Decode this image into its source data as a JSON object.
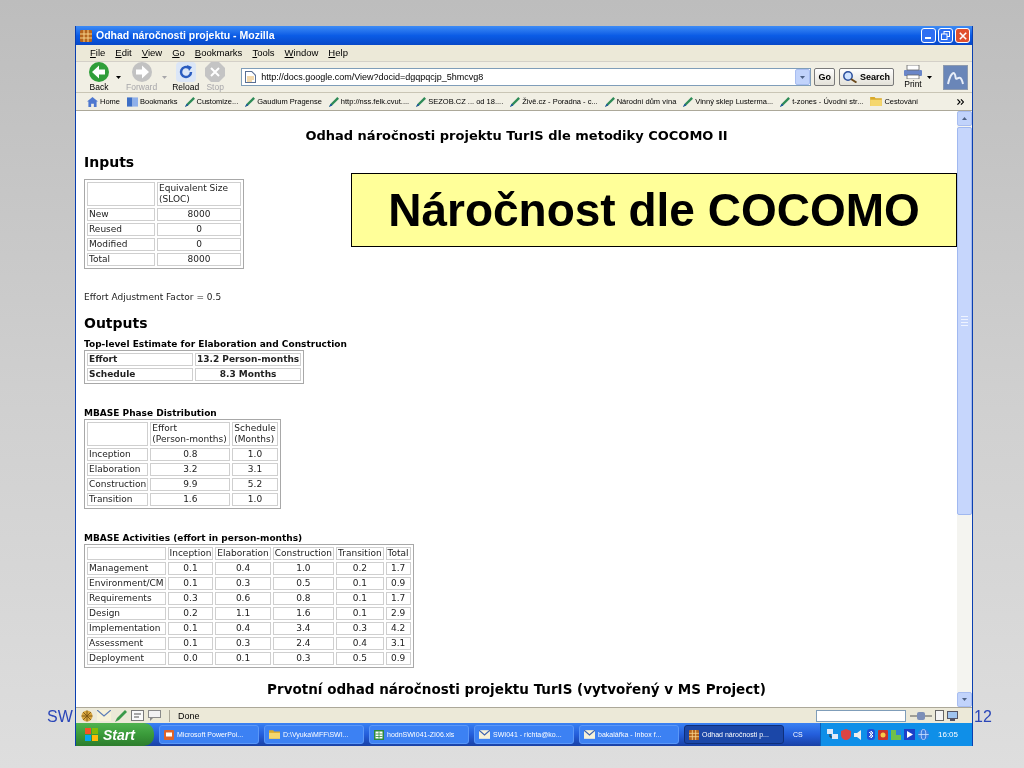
{
  "slide": {
    "footer_left": "SW",
    "page_number": "12",
    "callout": "Náročnost dle COCOMO"
  },
  "window": {
    "title": "Odhad náročnosti projektu - Mozilla"
  },
  "menu": [
    "File",
    "Edit",
    "View",
    "Go",
    "Bookmarks",
    "Tools",
    "Window",
    "Help"
  ],
  "navigation": [
    {
      "label": "Back",
      "kind": "back",
      "disabled": false,
      "has_menu": true
    },
    {
      "label": "Forward",
      "kind": "forward",
      "disabled": true,
      "has_menu": true
    },
    {
      "label": "Reload",
      "kind": "reload",
      "disabled": false,
      "has_menu": false
    },
    {
      "label": "Stop",
      "kind": "stop",
      "disabled": true,
      "has_menu": false
    }
  ],
  "address_bar": {
    "value": "http://docs.google.com/View?docid=dgqpqcjp_5hmcvg8"
  },
  "go_button": "Go",
  "search_button": "Search",
  "print_button": "Print",
  "bookmarks": [
    {
      "label": "Home",
      "kind": "home"
    },
    {
      "label": "Bookmarks",
      "kind": "bookmarks"
    },
    {
      "label": "Customize...",
      "kind": "link"
    },
    {
      "label": "Gaudium Pragense",
      "kind": "link"
    },
    {
      "label": "http://nss.felk.cvut....",
      "kind": "link"
    },
    {
      "label": "SEZOB.CZ ... od 18....",
      "kind": "link"
    },
    {
      "label": "Živě.cz - Poradna - c...",
      "kind": "link"
    },
    {
      "label": "Národní dům vína",
      "kind": "link"
    },
    {
      "label": "Vinný sklep Lusterma...",
      "kind": "link"
    },
    {
      "label": "t-zones - Úvodní str...",
      "kind": "link"
    },
    {
      "label": "Cestování",
      "kind": "folder"
    }
  ],
  "page": {
    "title": "Odhad náročnosti projektu TurIS dle metodiky COCOMO II",
    "inputs": {
      "heading": "Inputs",
      "columns": [
        "Equivalent Size (SLOC)"
      ],
      "rows": [
        {
          "label": "New",
          "values": [
            "8000"
          ]
        },
        {
          "label": "Reused",
          "values": [
            "0"
          ]
        },
        {
          "label": "Modified",
          "values": [
            "0"
          ]
        },
        {
          "label": "Total",
          "values": [
            "8000"
          ]
        }
      ]
    },
    "adjustment_factor": "Effort Adjustment Factor = 0.5",
    "outputs": {
      "heading": "Outputs",
      "estimate": {
        "caption": "Top-level Estimate for Elaboration and Construction",
        "rows": [
          {
            "label": "Effort",
            "value": "13.2 Person-months"
          },
          {
            "label": "Schedule",
            "value": "8.3 Months"
          }
        ]
      },
      "phase_distribution": {
        "caption": "MBASE Phase Distribution",
        "columns": [
          "Effort (Person-months)",
          "Schedule (Months)"
        ],
        "rows": [
          {
            "label": "Inception",
            "values": [
              "0.8",
              "1.0"
            ]
          },
          {
            "label": "Elaboration",
            "values": [
              "3.2",
              "3.1"
            ]
          },
          {
            "label": "Construction",
            "values": [
              "9.9",
              "5.2"
            ]
          },
          {
            "label": "Transition",
            "values": [
              "1.6",
              "1.0"
            ]
          }
        ]
      },
      "activities": {
        "caption": "MBASE Activities (effort in person-months)",
        "columns": [
          "Inception",
          "Elaboration",
          "Construction",
          "Transition",
          "Total"
        ],
        "rows": [
          {
            "label": "Management",
            "values": [
              "0.1",
              "0.4",
              "1.0",
              "0.2",
              "1.7"
            ]
          },
          {
            "label": "Environment/CM",
            "values": [
              "0.1",
              "0.3",
              "0.5",
              "0.1",
              "0.9"
            ]
          },
          {
            "label": "Requirements",
            "values": [
              "0.3",
              "0.6",
              "0.8",
              "0.1",
              "1.7"
            ]
          },
          {
            "label": "Design",
            "values": [
              "0.2",
              "1.1",
              "1.6",
              "0.1",
              "2.9"
            ]
          },
          {
            "label": "Implementation",
            "values": [
              "0.1",
              "0.4",
              "3.4",
              "0.3",
              "4.2"
            ]
          },
          {
            "label": "Assessment",
            "values": [
              "0.1",
              "0.3",
              "2.4",
              "0.4",
              "3.1"
            ]
          },
          {
            "label": "Deployment",
            "values": [
              "0.0",
              "0.1",
              "0.3",
              "0.5",
              "0.9"
            ]
          }
        ]
      }
    },
    "next_heading": "Prvotní odhad náročnosti projektu TurIS (vytvořený v MS Project)"
  },
  "status_bar": {
    "text": "Done"
  },
  "taskbar": {
    "start": "Start",
    "tasks": [
      {
        "label": "Microsoft PowerPoi...",
        "kind": "presentation",
        "selected": false
      },
      {
        "label": "D:\\Vyuka\\MFF\\SWI...",
        "kind": "folder",
        "selected": false
      },
      {
        "label": "hodnSWI041-ZI06.xls",
        "kind": "spreadsheet",
        "selected": false
      },
      {
        "label": "SWI041 - richta@ko...",
        "kind": "mail",
        "selected": false
      },
      {
        "label": "bakalářka - Inbox f...",
        "kind": "mail",
        "selected": false
      },
      {
        "label": "Odhad náročnosti p...",
        "kind": "browser",
        "selected": true
      }
    ],
    "language": "CS",
    "clock": "16:05"
  }
}
